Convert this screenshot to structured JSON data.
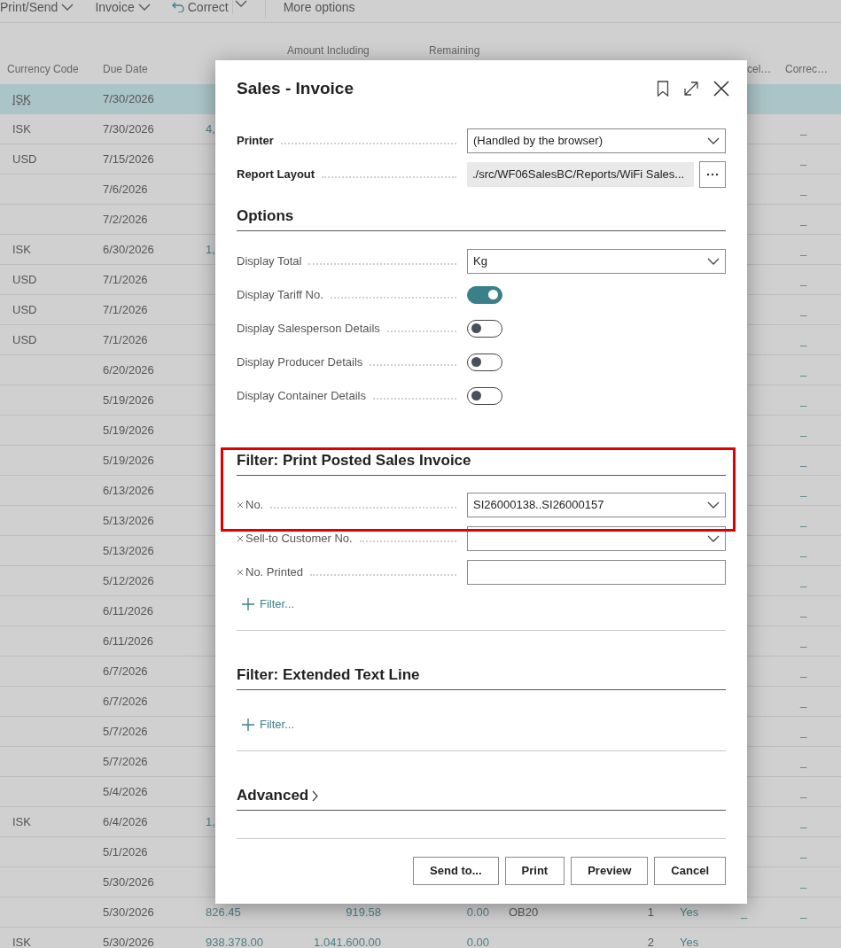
{
  "toolbar": [
    {
      "label": "Print/Send",
      "kind": "menu"
    },
    {
      "label": "Invoice",
      "kind": "menu"
    },
    {
      "label": "Correct",
      "kind": "split"
    },
    {
      "label": "More options",
      "kind": "plain"
    }
  ],
  "table": {
    "columns": {
      "currency_code": "Currency Code",
      "due_date": "Due Date",
      "amount_including": "Amount Including",
      "remaining": "Remaining",
      "column_9": "cel…",
      "column_10": "Correc…"
    },
    "rows": [
      {
        "selected": true,
        "currency_code": "ISK",
        "due_date": "7/30/2026"
      },
      {
        "selected": false,
        "currency_code": "ISK",
        "due_date": "7/30/2026",
        "amount": "4,",
        "column_10": "_"
      },
      {
        "selected": false,
        "currency_code": "USD",
        "due_date": "7/15/2026",
        "column_10": "_"
      },
      {
        "selected": false,
        "due_date": "7/6/2026",
        "column_10": "_"
      },
      {
        "selected": false,
        "due_date": "7/2/2026",
        "column_10": "_"
      },
      {
        "selected": false,
        "currency_code": "ISK",
        "due_date": "6/30/2026",
        "amount": "1,",
        "column_10": "_"
      },
      {
        "selected": false,
        "currency_code": "USD",
        "due_date": "7/1/2026",
        "column_10": "_"
      },
      {
        "selected": false,
        "currency_code": "USD",
        "due_date": "7/1/2026",
        "column_10": "_"
      },
      {
        "selected": false,
        "currency_code": "USD",
        "due_date": "7/1/2026",
        "column_10": "_"
      },
      {
        "selected": false,
        "due_date": "6/20/2026",
        "column_10": "_"
      },
      {
        "selected": false,
        "due_date": "5/19/2026",
        "column_10": "_"
      },
      {
        "selected": false,
        "due_date": "5/19/2026",
        "column_10": "_"
      },
      {
        "selected": false,
        "due_date": "5/19/2026",
        "column_10": "_"
      },
      {
        "selected": false,
        "due_date": "6/13/2026",
        "column_10": "_"
      },
      {
        "selected": false,
        "due_date": "5/13/2026",
        "column_10": "_"
      },
      {
        "selected": false,
        "due_date": "5/13/2026",
        "column_10": "_"
      },
      {
        "selected": false,
        "due_date": "5/12/2026",
        "column_10": "_"
      },
      {
        "selected": false,
        "due_date": "6/11/2026",
        "column_10": "_"
      },
      {
        "selected": false,
        "due_date": "6/11/2026",
        "column_10": "_"
      },
      {
        "selected": false,
        "due_date": "6/7/2026",
        "column_10": "_"
      },
      {
        "selected": false,
        "due_date": "6/7/2026",
        "column_10": "_"
      },
      {
        "selected": false,
        "due_date": "5/7/2026",
        "column_10": "_"
      },
      {
        "selected": false,
        "due_date": "5/7/2026",
        "column_10": "_"
      },
      {
        "selected": false,
        "due_date": "5/4/2026",
        "column_10": "_"
      },
      {
        "selected": false,
        "currency_code": "ISK",
        "due_date": "6/4/2026",
        "amount": "1,",
        "column_10": "_"
      },
      {
        "selected": false,
        "due_date": "5/1/2026",
        "column_10": "_"
      },
      {
        "selected": false,
        "due_date": "5/30/2026",
        "column_10": "_"
      },
      {
        "selected": false,
        "due_date": "5/30/2026",
        "amount": "826.45",
        "amount_including": "919.58",
        "remaining": "0.00",
        "column_6": "OB20",
        "column_7": "1",
        "column_8": "Yes",
        "column_9": "_",
        "column_10": "_"
      },
      {
        "selected": false,
        "currency_code": "ISK",
        "due_date": "5/30/2026",
        "amount": "938.378.00",
        "amount_including": "1.041.600.00",
        "remaining": "0.00",
        "column_7": "2",
        "column_8": "Yes"
      }
    ]
  },
  "dialog": {
    "title": "Sales - Invoice",
    "printer": {
      "label": "Printer",
      "value": "(Handled by the browser)"
    },
    "report_layout": {
      "label": "Report Layout",
      "value": "./src/WF06SalesBC/Reports/WiFi Sales..."
    },
    "sections": [
      {
        "title": "Options",
        "kind": "options",
        "highlighted": false,
        "fields": [
          {
            "kind": "select",
            "label": "Display Total",
            "value": "Kg"
          },
          {
            "kind": "toggle",
            "label": "Display Tariff No.",
            "on": true
          },
          {
            "kind": "toggle",
            "label": "Display Salesperson Details",
            "on": false
          },
          {
            "kind": "toggle",
            "label": "Display Producer Details",
            "on": false
          },
          {
            "kind": "toggle",
            "label": "Display Container Details",
            "on": false
          }
        ]
      },
      {
        "title": "Filter: Print Posted Sales Invoice",
        "kind": "filter",
        "highlighted": true,
        "fields": [
          {
            "kind": "select",
            "label": "No.",
            "value": "SI26000138..SI26000157"
          },
          {
            "kind": "select",
            "label": "Sell-to Customer No."
          },
          {
            "kind": "text",
            "label": "No. Printed"
          }
        ],
        "add_filter": "Filter..."
      },
      {
        "title": "Filter: Extended Text Line",
        "kind": "filter",
        "highlighted": false,
        "add_filter": "Filter..."
      },
      {
        "title": "Advanced",
        "kind": "collapsed",
        "highlighted": false
      }
    ],
    "buttons": [
      "Send to...",
      "Print",
      "Preview",
      "Cancel"
    ]
  }
}
